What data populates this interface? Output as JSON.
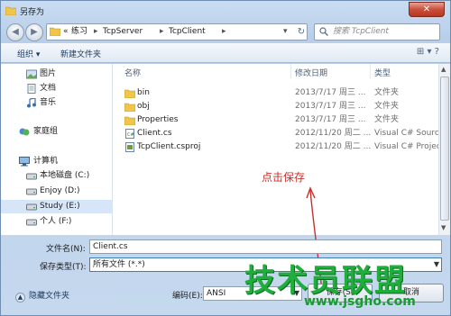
{
  "window": {
    "title": "另存为",
    "close_label": "✕"
  },
  "address": {
    "prefix": "«",
    "segments": [
      "练习",
      "TcpServer",
      "TcpClient"
    ],
    "separator": "▸",
    "dropdown": "▾",
    "refresh": "↻"
  },
  "search": {
    "placeholder": "搜索 TcpClient"
  },
  "toolbar": {
    "organize": "组织 ▾",
    "new_folder": "新建文件夹",
    "view": "⊞ ▾  ?"
  },
  "sidebar": {
    "items": [
      {
        "label": "图片",
        "icon": "pictures-icon"
      },
      {
        "label": "文档",
        "icon": "documents-icon"
      },
      {
        "label": "音乐",
        "icon": "music-icon"
      },
      {
        "label": "家庭组",
        "icon": "homegroup-icon"
      },
      {
        "label": "计算机",
        "icon": "computer-icon"
      },
      {
        "label": "本地磁盘 (C:)",
        "icon": "drive-icon"
      },
      {
        "label": "Enjoy (D:)",
        "icon": "drive-icon"
      },
      {
        "label": "Study (E:)",
        "icon": "drive-icon"
      },
      {
        "label": "个人 (F:)",
        "icon": "drive-icon"
      }
    ]
  },
  "columns": {
    "name": "名称",
    "date": "修改日期",
    "type": "类型"
  },
  "files": [
    {
      "name": "bin",
      "date": "2013/7/17 周三 ...",
      "type": "文件夹",
      "kind": "folder"
    },
    {
      "name": "obj",
      "date": "2013/7/17 周三 ...",
      "type": "文件夹",
      "kind": "folder"
    },
    {
      "name": "Properties",
      "date": "2013/7/17 周三 ...",
      "type": "文件夹",
      "kind": "folder"
    },
    {
      "name": "Client.cs",
      "date": "2012/11/20 周二 ...",
      "type": "Visual C# Sourc...",
      "kind": "cs"
    },
    {
      "name": "TcpClient.csproj",
      "date": "2012/11/20 周二 ...",
      "type": "Visual C# Projec...",
      "kind": "csproj"
    }
  ],
  "annotation": {
    "text": "点击保存"
  },
  "save": {
    "filename_label": "文件名(N):",
    "filename_value": "Client.cs",
    "type_label": "保存类型(T):",
    "type_value": "所有文件 (*.*)"
  },
  "footer": {
    "hide_folders": "隐藏文件夹",
    "encoding_label": "编码(E):",
    "encoding_value": "ANSI",
    "save_button": "保存(S)",
    "cancel_button": "取消"
  },
  "watermark": {
    "text": "技术员联盟",
    "url": "www.jsgho.com"
  },
  "colors": {
    "annotation": "#c8302c",
    "watermark": "#1fae3c",
    "accent": "#3c7fb1"
  }
}
